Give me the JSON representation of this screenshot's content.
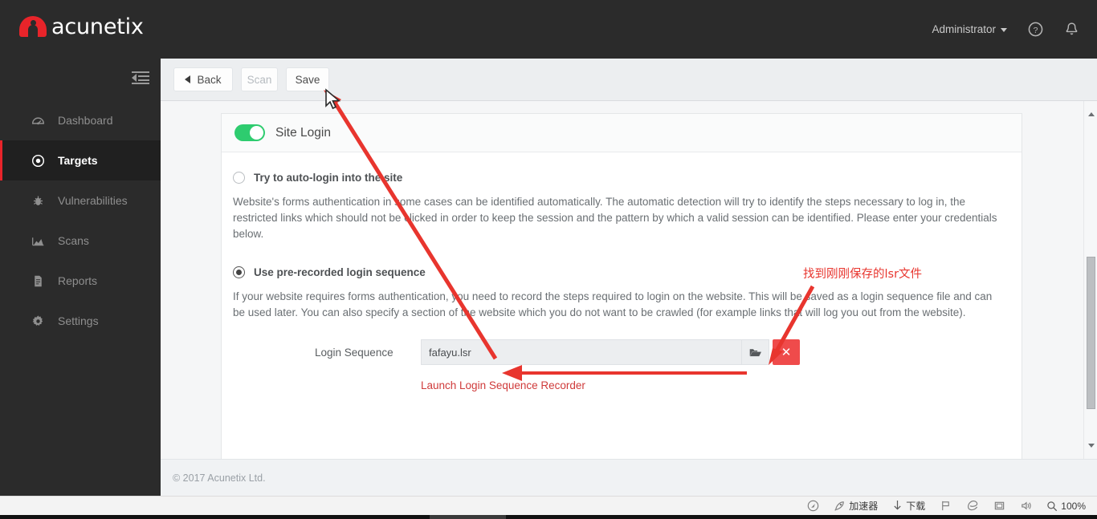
{
  "header": {
    "brand": "acunetix",
    "brand_color": "#e8242a",
    "user_label": "Administrator",
    "help_icon": "help-circle-icon",
    "bell_icon": "notification-bell-icon"
  },
  "sidebar": {
    "collapse_icon": "collapse-sidebar-icon",
    "items": [
      {
        "label": "Dashboard",
        "icon": "gauge-icon",
        "active": false
      },
      {
        "label": "Targets",
        "icon": "target-icon",
        "active": true
      },
      {
        "label": "Vulnerabilities",
        "icon": "bug-icon",
        "active": false
      },
      {
        "label": "Scans",
        "icon": "area-chart-icon",
        "active": false
      },
      {
        "label": "Reports",
        "icon": "document-icon",
        "active": false
      },
      {
        "label": "Settings",
        "icon": "gear-icon",
        "active": false
      }
    ],
    "active_accent": "#e8242a"
  },
  "toolbar": {
    "back_label": "Back",
    "back_icon": "chevron-left-icon",
    "scan_label": "Scan",
    "scan_disabled": true,
    "save_label": "Save"
  },
  "card": {
    "toggle_state": "on",
    "toggle_color": "#2ecc6f",
    "title": "Site Login",
    "option_auto": {
      "label": "Try to auto-login into the site",
      "selected": false,
      "description": "Website's forms authentication in some cases can be identified automatically. The automatic detection will try to identify the steps necessary to log in, the restricted links which should not be clicked in order to keep the session and the pattern by which a valid session can be identified. Please enter your credentials below."
    },
    "option_prerecorded": {
      "label": "Use pre-recorded login sequence",
      "selected": true,
      "description": "If your website requires forms authentication, you need to record the steps required to login on the website. This will be saved as a login sequence file and can be used later. You can also specify a section of the website which you do not want to be crawled (for example links that will log you out from the website)."
    },
    "login_sequence": {
      "label": "Login Sequence",
      "value": "fafayu.lsr",
      "placeholder": "",
      "browse_icon": "folder-open-icon",
      "clear_icon": "close-x-icon",
      "clear_color": "#ef4b4b"
    },
    "recorder_link": "Launch Login Sequence Recorder",
    "recorder_link_color": "#cf3a3a"
  },
  "footer": {
    "copyright": "© 2017 Acunetix Ltd."
  },
  "scrollbar": {
    "up_icon": "scroll-up-arrow-icon",
    "down_icon": "scroll-down-arrow-icon",
    "thumb": "scrollbar-thumb"
  },
  "annotations": {
    "note_text": "找到刚刚保存的lsr文件",
    "note_color": "#e8352e",
    "arrow_color": "#e8352e",
    "arrow_to_save": "points from login sequence field up to Save button",
    "arrow_to_browse": "points down-left to folder browse button",
    "arrow_to_input": "points left into login sequence input"
  },
  "statusbar": {
    "items": [
      {
        "label": "",
        "icon": "shield-compass-icon"
      },
      {
        "label": "加速器",
        "icon": "rocket-icon"
      },
      {
        "label": "下载",
        "icon": "download-arrow-icon"
      },
      {
        "label": "",
        "icon": "flag-icon"
      },
      {
        "label": "",
        "icon": "ie-browser-icon"
      },
      {
        "label": "",
        "icon": "window-icon"
      },
      {
        "label": "",
        "icon": "speaker-icon"
      },
      {
        "label": "100%",
        "icon": "zoom-magnifier-icon"
      }
    ]
  }
}
